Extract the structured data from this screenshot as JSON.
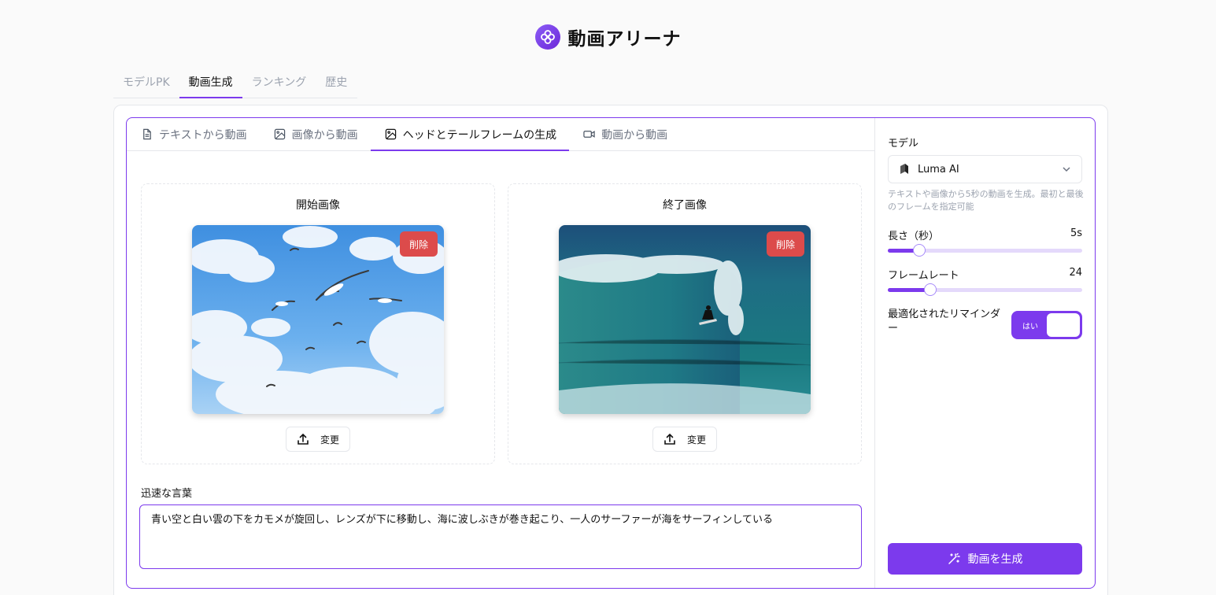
{
  "app": {
    "title": "動画アリーナ"
  },
  "main_tabs": [
    {
      "label": "モデルPK"
    },
    {
      "label": "動画生成"
    },
    {
      "label": "ランキング"
    },
    {
      "label": "歴史"
    }
  ],
  "sub_tabs": [
    {
      "label": "テキストから動画",
      "icon": "document-icon"
    },
    {
      "label": "画像から動画",
      "icon": "image-icon"
    },
    {
      "label": "ヘッドとテールフレームの生成",
      "icon": "image-icon"
    },
    {
      "label": "動画から動画",
      "icon": "video-icon"
    }
  ],
  "start_panel": {
    "title": "開始画像",
    "delete_label": "削除",
    "change_label": "変更"
  },
  "end_panel": {
    "title": "終了画像",
    "delete_label": "削除",
    "change_label": "変更"
  },
  "prompt": {
    "label": "迅速な言葉",
    "value": "青い空と白い雲の下をカモメが旋回し、レンズが下に移動し、海に波しぶきが巻き起こり、一人のサーファーが海をサーフィンしている"
  },
  "settings": {
    "model_label": "モデル",
    "model_value": "Luma AI",
    "model_description": "テキストや画像から5秒の動画を生成。最初と最後のフレームを指定可能",
    "duration_label": "長さ（秒）",
    "duration_value": "5s",
    "duration_fraction": 0.16,
    "fps_label": "フレームレート",
    "fps_value": "24",
    "fps_fraction": 0.22,
    "reminder_label": "最適化されたリマインダー",
    "reminder_toggle_text": "はい",
    "reminder_on": true
  },
  "generate_button": {
    "label": "動画を生成"
  },
  "colors": {
    "accent": "#7c3aed",
    "delete": "#dc4b4b"
  }
}
